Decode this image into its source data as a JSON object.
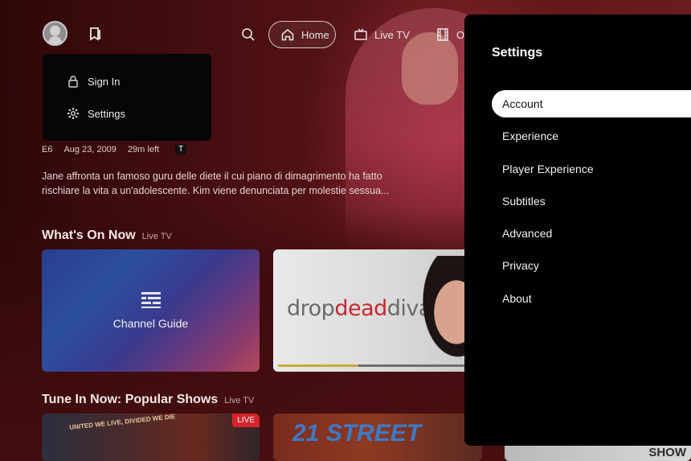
{
  "nav": {
    "home_label": "Home",
    "live_tv_label": "Live TV",
    "on_demand_label": "On"
  },
  "account_menu": {
    "sign_in_label": "Sign In",
    "settings_label": "Settings"
  },
  "hero": {
    "episode": "E6",
    "date": "Aug 23, 2009",
    "time_left": "29m left",
    "rating": "T",
    "description": "Jane affronta un famoso guru delle diete il cui piano di dimagrimento ha fatto rischiare la vita a un'adolescente. Kim viene denunciata per molestie sessua..."
  },
  "sections": {
    "whats_on_now": {
      "title": "What's On Now",
      "subtitle": "Live TV"
    },
    "tune_in_now": {
      "title": "Tune In Now: Popular Shows",
      "subtitle": "Live TV"
    }
  },
  "cards": {
    "channel_guide_label": "Channel Guide",
    "drop_dead_diva": {
      "word1": "drop",
      "word2": "dead",
      "word3": "diva",
      "progress_percent": 40
    },
    "show1_poster_text": "UNITED WE LIVE, DIVIDED WE DIE",
    "show1_badge": "LIVE",
    "show2_poster_text": "21 STREET",
    "show3_poster_text": "SHOW"
  },
  "settings": {
    "title": "Settings",
    "items": [
      {
        "label": "Account",
        "active": true
      },
      {
        "label": "Experience",
        "active": false
      },
      {
        "label": "Player Experience",
        "active": false
      },
      {
        "label": "Subtitles",
        "active": false
      },
      {
        "label": "Advanced",
        "active": false
      },
      {
        "label": "Privacy",
        "active": false
      },
      {
        "label": "About",
        "active": false
      }
    ]
  },
  "colors": {
    "background": "#5a1416",
    "panel": "#000000",
    "live_badge": "#d6232c",
    "progress": "#c9a83a",
    "diva_accent": "#c6282f"
  }
}
